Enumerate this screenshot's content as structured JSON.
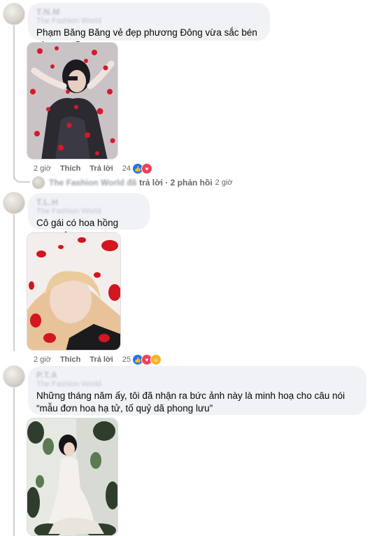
{
  "comments": [
    {
      "author": "T.N.M",
      "author_sub": "The Fashion World",
      "text": "Phạm Băng Băng vẻ đẹp phương Đông vừa sắc bén vừa rực rỡ",
      "time": "2 giờ",
      "like_label": "Thích",
      "reply_label": "Trả lời",
      "reaction_count": "24",
      "reactions": [
        "like-icon",
        "love-icon"
      ],
      "replies": {
        "author": "The Fashion World đã",
        "text": "trả lời · 2 phản hồi",
        "time": "2 giờ"
      }
    },
    {
      "author": "T.L.H",
      "author_sub": "The Fashion World",
      "text": "Cô gái có hoa hồng trong tên",
      "time": "2 giờ",
      "like_label": "Thích",
      "reply_label": "Trả lời",
      "reaction_count": "25",
      "reactions": [
        "like-icon",
        "love-icon",
        "haha-icon"
      ]
    },
    {
      "author": "P.T.A",
      "author_sub": "The Fashion World",
      "text": "Những tháng năm ấy, tôi đã nhận ra bức ảnh này là minh hoạ cho câu nói “mẫu đơn hoa hạ tử, tố quỷ dã phong lưu”"
    }
  ],
  "colors": {
    "bubble": "#f0f2f5",
    "like": "#1877f2",
    "love": "#f33e58",
    "haha": "#f7b125",
    "meta": "#65676b"
  }
}
